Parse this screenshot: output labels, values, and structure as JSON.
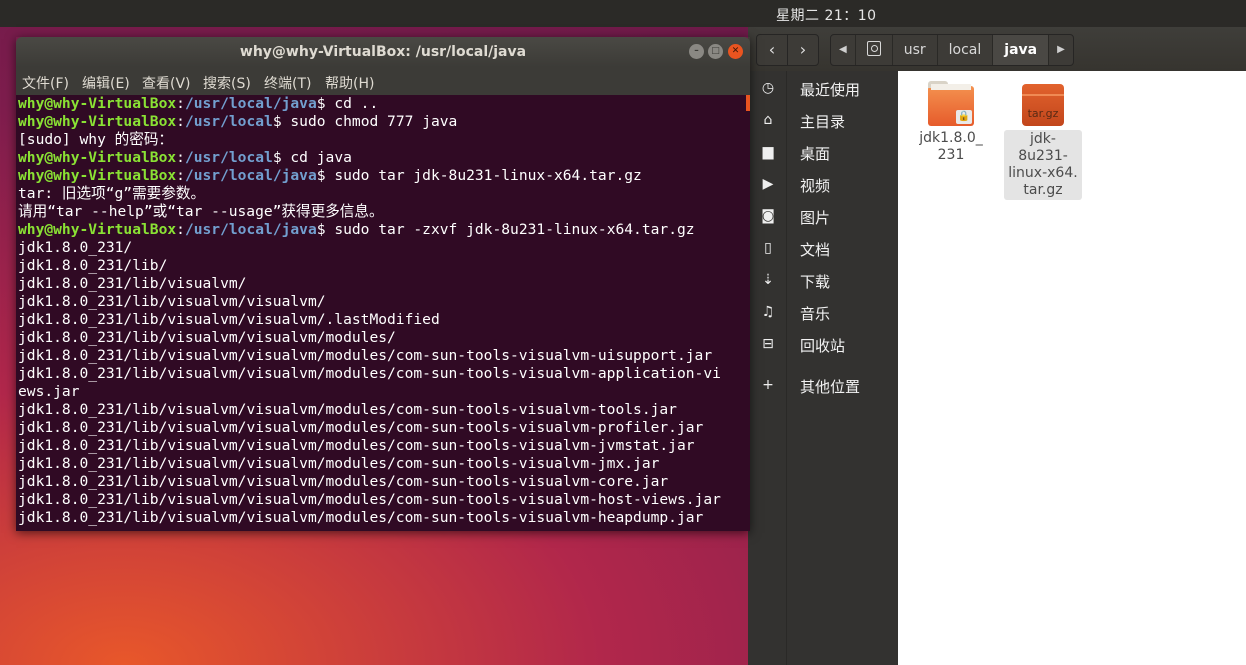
{
  "topbar": {
    "clock": "星期二 21：10"
  },
  "file_manager": {
    "nav": {
      "back_icon": "‹",
      "forward_icon": "›"
    },
    "breadcrumbs": [
      {
        "label": "usr"
      },
      {
        "label": "local"
      },
      {
        "label": "java",
        "active": true
      }
    ],
    "sidebar": [
      {
        "label": "最近使用",
        "icon": "clock-icon"
      },
      {
        "label": "主目录",
        "icon": "home-icon"
      },
      {
        "label": "桌面",
        "icon": "folder-icon"
      },
      {
        "label": "视频",
        "icon": "video-icon"
      },
      {
        "label": "图片",
        "icon": "camera-icon"
      },
      {
        "label": "文档",
        "icon": "document-icon"
      },
      {
        "label": "下载",
        "icon": "download-icon"
      },
      {
        "label": "音乐",
        "icon": "music-icon"
      },
      {
        "label": "回收站",
        "icon": "trash-icon"
      },
      {
        "label": "其他位置",
        "icon": "plus-icon"
      }
    ],
    "files": [
      {
        "name_l1": "jdk1.8.0_",
        "name_l2": "231",
        "name_l3": "",
        "kind": "folder"
      },
      {
        "name_l1": "jdk-8u231-",
        "name_l2": "linux-x64.",
        "name_l3": "tar.gz",
        "kind": "archive",
        "badge": "tar.gz"
      }
    ]
  },
  "terminal": {
    "title": "why@why-VirtualBox: /usr/local/java",
    "menu": [
      "文件(F)",
      "编辑(E)",
      "查看(V)",
      "搜索(S)",
      "终端(T)",
      "帮助(H)"
    ],
    "lines": [
      {
        "user": "why@why-VirtualBox",
        "path": "/usr/local/java",
        "cmd": "$ cd .."
      },
      {
        "user": "why@why-VirtualBox",
        "path": "/usr/local",
        "cmd": "$ sudo chmod 777 java"
      },
      {
        "text": "[sudo] why 的密码："
      },
      {
        "user": "why@why-VirtualBox",
        "path": "/usr/local",
        "cmd": "$ cd java"
      },
      {
        "user": "why@why-VirtualBox",
        "path": "/usr/local/java",
        "cmd": "$ sudo tar jdk-8u231-linux-x64.tar.gz"
      },
      {
        "text": "tar: 旧选项“g”需要参数。"
      },
      {
        "text": "请用“tar --help”或“tar --usage”获得更多信息。"
      },
      {
        "user": "why@why-VirtualBox",
        "path": "/usr/local/java",
        "cmd": "$ sudo tar -zxvf jdk-8u231-linux-x64.tar.gz"
      },
      {
        "text": "jdk1.8.0_231/"
      },
      {
        "text": "jdk1.8.0_231/lib/"
      },
      {
        "text": "jdk1.8.0_231/lib/visualvm/"
      },
      {
        "text": "jdk1.8.0_231/lib/visualvm/visualvm/"
      },
      {
        "text": "jdk1.8.0_231/lib/visualvm/visualvm/.lastModified"
      },
      {
        "text": "jdk1.8.0_231/lib/visualvm/visualvm/modules/"
      },
      {
        "text": "jdk1.8.0_231/lib/visualvm/visualvm/modules/com-sun-tools-visualvm-uisupport.jar"
      },
      {
        "text": "jdk1.8.0_231/lib/visualvm/visualvm/modules/com-sun-tools-visualvm-application-vi"
      },
      {
        "text": "ews.jar"
      },
      {
        "text": "jdk1.8.0_231/lib/visualvm/visualvm/modules/com-sun-tools-visualvm-tools.jar"
      },
      {
        "text": "jdk1.8.0_231/lib/visualvm/visualvm/modules/com-sun-tools-visualvm-profiler.jar"
      },
      {
        "text": "jdk1.8.0_231/lib/visualvm/visualvm/modules/com-sun-tools-visualvm-jvmstat.jar"
      },
      {
        "text": "jdk1.8.0_231/lib/visualvm/visualvm/modules/com-sun-tools-visualvm-jmx.jar"
      },
      {
        "text": "jdk1.8.0_231/lib/visualvm/visualvm/modules/com-sun-tools-visualvm-core.jar"
      },
      {
        "text": "jdk1.8.0_231/lib/visualvm/visualvm/modules/com-sun-tools-visualvm-host-views.jar"
      },
      {
        "text": "jdk1.8.0_231/lib/visualvm/visualvm/modules/com-sun-tools-visualvm-heapdump.jar"
      }
    ]
  },
  "colors": {
    "accent": "#e95420",
    "terminal_bg": "#300a24",
    "prompt_user": "#8ae234",
    "prompt_path": "#729fcf"
  }
}
